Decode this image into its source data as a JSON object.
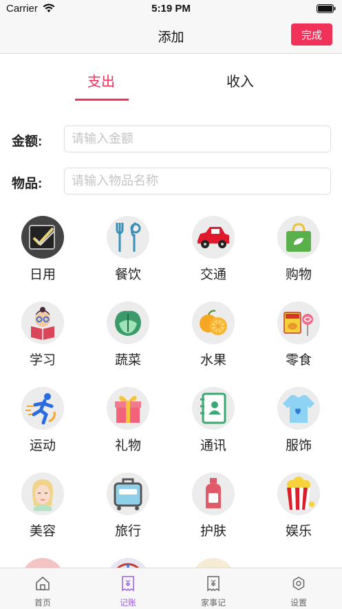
{
  "status": {
    "carrier": "Carrier",
    "time": "5:19 PM"
  },
  "nav": {
    "title": "添加",
    "done": "完成"
  },
  "tabs": {
    "expense": "支出",
    "income": "收入",
    "active": "expense"
  },
  "form": {
    "amount_label": "金额:",
    "amount_placeholder": "请输入金额",
    "item_label": "物品:",
    "item_placeholder": "请输入物品名称"
  },
  "categories": [
    {
      "label": "日用",
      "icon": "daily-use-icon"
    },
    {
      "label": "餐饮",
      "icon": "dining-icon"
    },
    {
      "label": "交通",
      "icon": "car-icon"
    },
    {
      "label": "购物",
      "icon": "shopping-bag-icon"
    },
    {
      "label": "学习",
      "icon": "study-icon"
    },
    {
      "label": "蔬菜",
      "icon": "vegetable-icon"
    },
    {
      "label": "水果",
      "icon": "fruit-icon"
    },
    {
      "label": "零食",
      "icon": "snack-icon"
    },
    {
      "label": "运动",
      "icon": "sport-icon"
    },
    {
      "label": "礼物",
      "icon": "gift-icon"
    },
    {
      "label": "通讯",
      "icon": "contacts-icon"
    },
    {
      "label": "服饰",
      "icon": "clothes-icon"
    },
    {
      "label": "美容",
      "icon": "beauty-icon"
    },
    {
      "label": "旅行",
      "icon": "luggage-icon"
    },
    {
      "label": "护肤",
      "icon": "skincare-icon"
    },
    {
      "label": "娱乐",
      "icon": "popcorn-icon"
    }
  ],
  "tabbar": [
    {
      "label": "首页",
      "icon": "home-icon"
    },
    {
      "label": "记账",
      "icon": "bill-icon",
      "active": true
    },
    {
      "label": "家事记",
      "icon": "bill-icon"
    },
    {
      "label": "设置",
      "icon": "settings-icon"
    }
  ],
  "colors": {
    "accent": "#f0325a",
    "tab_active": "#9b5de5"
  }
}
